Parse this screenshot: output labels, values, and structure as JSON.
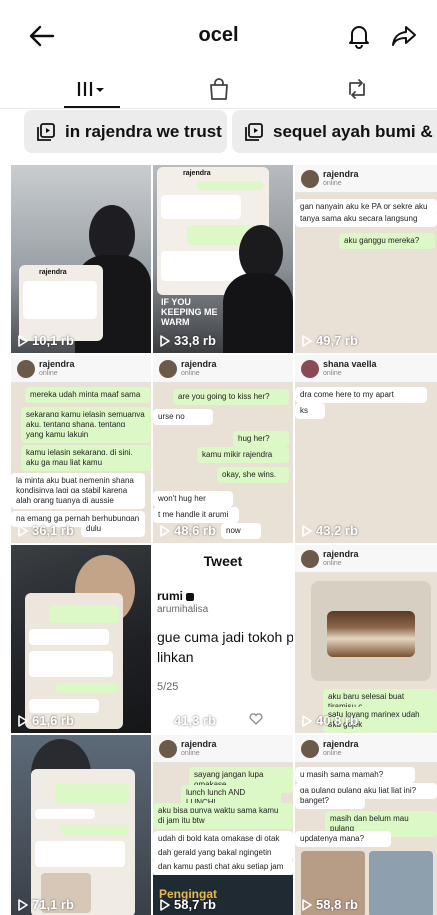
{
  "header": {
    "title": "ocel"
  },
  "tabs": [
    {
      "name": "grid"
    },
    {
      "name": "shop"
    },
    {
      "name": "reposts"
    }
  ],
  "chips": [
    {
      "label": "in rajendra we trust"
    },
    {
      "label": "sequel ayah bumi & b"
    }
  ],
  "posts": [
    {
      "views": "10,1 rb",
      "chat_name": "rajendra",
      "texts": []
    },
    {
      "views": "33,8 rb",
      "chat_name": "rajendra",
      "overlay": "IF YOU KEEPING ME WARM",
      "texts": []
    },
    {
      "views": "49,7 rb",
      "chat_name": "rajendra",
      "chat_sub": "online",
      "texts": [
        "gan nanyain aku ke PA or sekre aku",
        "tanya sama aku secara langsung",
        "aku ganggu mereka?"
      ]
    },
    {
      "views": "36,1 rb",
      "chat_name": "rajendra",
      "chat_sub": "online",
      "texts": [
        "mereka udah minta maaf sama",
        "sekarang kamu jelasin semuanya sa",
        "aku. tentang shana, tentang semua",
        "yang kamu lakuin",
        "kamu jelasin sekarang, di sini, kar",
        "aku ga mau liat kamu",
        "la minta aku buat nemenin shana",
        "kondisinya lagi ga stabil karena",
        "alah orang tuanya di aussie",
        "na emang ga pernah berhubungan",
        "dulu"
      ]
    },
    {
      "views": "48,6 rb",
      "chat_name": "rajendra",
      "chat_sub": "online",
      "texts": [
        "are you going to kiss her?",
        "urse no",
        "hug her?",
        "kamu mikir rajendra",
        "okay, she wins.",
        "won't hug her",
        "t me handle it arumi",
        "now"
      ]
    },
    {
      "views": "43,2 rb",
      "chat_name": "shana vaella",
      "chat_sub": "online",
      "texts": [
        "dra come here to my apart",
        "ks"
      ]
    },
    {
      "views": "61,6 rb",
      "chat_name": "",
      "texts": []
    },
    {
      "views": "41,3 rb",
      "tweet_title": "Tweet",
      "tweet_user": "rumi",
      "tweet_handle": "arumihalisa",
      "tweet_text": "gue cuma jadi tokoh pa",
      "tweet_text2": "lihkan",
      "tweet_date": "5/25",
      "texts": []
    },
    {
      "views": "40,8 rb",
      "chat_name": "rajendra",
      "chat_sub": "online",
      "texts": [
        "aku baru selesai buat tiramisu c",
        "satu loyang marinex udah aku gojek"
      ]
    },
    {
      "views": "71,1 rb",
      "chat_name": "",
      "texts": []
    },
    {
      "views": "58,7 rb",
      "chat_name": "rajendra",
      "chat_sub": "online",
      "overlay": "Pengingat",
      "texts": [
        "sayang jangan lupa omakase",
        "lunch lunch AND LUNCH!",
        "aku bisa punya waktu sama kamu cuma",
        "di jam itu btw",
        "udah di bold kata omakase di otak aku",
        "dah gerald yang bakal ngingetin",
        "dan kamu pasti chat aku setiap jam"
      ]
    },
    {
      "views": "58,8 rb",
      "chat_name": "rajendra",
      "chat_sub": "online",
      "texts": [
        "u masih sama mamah?",
        "ga pulang pulang aku liat liat ini?",
        "banget?",
        "masih dan belum mau pulang",
        "updatenya mana?"
      ]
    }
  ],
  "colors": {
    "chip_bg": "#ececec",
    "bubble_out": "#dcf8c6",
    "chat_bg": "#e9e1d6"
  }
}
